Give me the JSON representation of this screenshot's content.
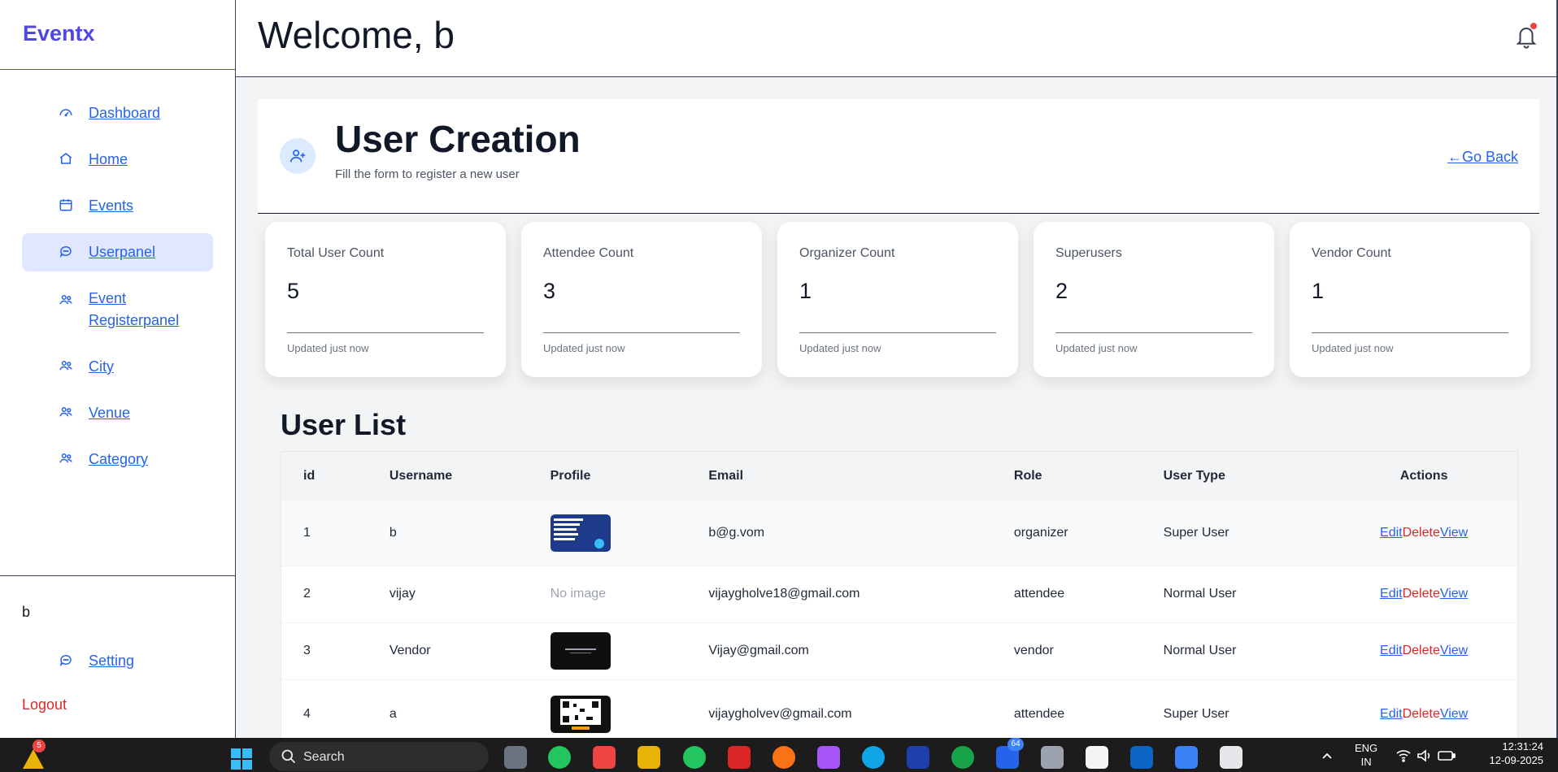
{
  "app": {
    "brand": "Eventx"
  },
  "sidebar": {
    "items": [
      {
        "label": "Dashboard",
        "icon": "dashboard-icon",
        "active": false
      },
      {
        "label": "Home",
        "icon": "home-icon",
        "active": false
      },
      {
        "label": "Events",
        "icon": "calendar-icon",
        "active": false
      },
      {
        "label": "Userpanel",
        "icon": "chat-icon",
        "active": true
      },
      {
        "label": "Event Registerpanel",
        "icon": "users-icon",
        "active": false
      },
      {
        "label": "City",
        "icon": "users-icon",
        "active": false
      },
      {
        "label": "Venue",
        "icon": "users-icon",
        "active": false
      },
      {
        "label": "Category",
        "icon": "users-icon",
        "active": false
      }
    ],
    "user_name": "b",
    "setting_label": "Setting",
    "logout_label": "Logout"
  },
  "header": {
    "welcome": "Welcome, b"
  },
  "page": {
    "title": "User Creation",
    "subtitle": "Fill the form to register a new user",
    "go_back": "←Go Back"
  },
  "stats": [
    {
      "label": "Total User Count",
      "value": "5",
      "updated": "Updated just now"
    },
    {
      "label": "Attendee Count",
      "value": "3",
      "updated": "Updated just now"
    },
    {
      "label": "Organizer Count",
      "value": "1",
      "updated": "Updated just now"
    },
    {
      "label": "Superusers",
      "value": "2",
      "updated": "Updated just now"
    },
    {
      "label": "Vendor Count",
      "value": "1",
      "updated": "Updated just now"
    }
  ],
  "user_list": {
    "title": "User List",
    "columns": [
      "id",
      "Username",
      "Profile",
      "Email",
      "Role",
      "User Type",
      "Actions"
    ],
    "actions": {
      "edit": "Edit",
      "delete": "Delete",
      "view": "View"
    },
    "no_image": "No image",
    "rows": [
      {
        "id": "1",
        "username": "b",
        "profile": "image-blue",
        "email": "b@g.vom",
        "role": "organizer",
        "user_type": "Super User"
      },
      {
        "id": "2",
        "username": "vijay",
        "profile": "none",
        "email": "vijaygholve18@gmail.com",
        "role": "attendee",
        "user_type": "Normal User"
      },
      {
        "id": "3",
        "username": "Vendor",
        "profile": "image-dark",
        "email": "Vijay@gmail.com",
        "role": "vendor",
        "user_type": "Normal User"
      },
      {
        "id": "4",
        "username": "a",
        "profile": "image-qr",
        "email": "vijaygholvev@gmail.com",
        "role": "attendee",
        "user_type": "Super User"
      }
    ]
  },
  "taskbar": {
    "search": "Search",
    "weather_badge": "5",
    "notification_badge": "64",
    "lang_top": "ENG",
    "lang_bottom": "IN",
    "time": "12:31:24",
    "date": "12-09-2025"
  },
  "colors": {
    "brand": "#4f46e5",
    "link": "#2563eb",
    "danger": "#dc2626",
    "active_bg": "#e0e7ff"
  }
}
